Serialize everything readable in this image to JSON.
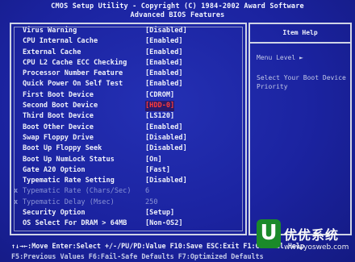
{
  "header": {
    "line1": "CMOS Setup Utility - Copyright (C) 1984-2002 Award Software",
    "line2": "Advanced BIOS Features"
  },
  "settings": [
    {
      "label": "Virus Warning",
      "value": "[Disabled]"
    },
    {
      "label": "CPU Internal Cache",
      "value": "[Enabled]"
    },
    {
      "label": "External Cache",
      "value": "[Enabled]"
    },
    {
      "label": "CPU L2 Cache ECC Checking",
      "value": "[Enabled]"
    },
    {
      "label": "Processor Number Feature",
      "value": "[Enabled]"
    },
    {
      "label": "Quick Power On Self Test",
      "value": "[Enabled]"
    },
    {
      "label": "First Boot Device",
      "value": "[CDROM]"
    },
    {
      "label": "Second Boot Device",
      "value": "[HDD-0]"
    },
    {
      "label": "Third Boot Device",
      "value": "[LS120]"
    },
    {
      "label": "Boot Other Device",
      "value": "[Enabled]"
    },
    {
      "label": "Swap Floppy Drive",
      "value": "[Disabled]"
    },
    {
      "label": "Boot Up Floppy Seek",
      "value": "[Disabled]"
    },
    {
      "label": "Boot Up NumLock Status",
      "value": "[On]"
    },
    {
      "label": "Gate A20 Option",
      "value": "[Fast]"
    },
    {
      "label": "Typematic Rate Setting",
      "value": "[Disabled]"
    },
    {
      "label": "Typematic Rate (Chars/Sec)",
      "value": "6"
    },
    {
      "label": "Typematic Delay (Msec)",
      "value": "250"
    },
    {
      "label": "Security Option",
      "value": "[Setup]"
    },
    {
      "label": "OS Select For DRAM > 64MB",
      "value": "[Non-OS2]"
    }
  ],
  "dim_marker": "x",
  "help": {
    "title": "Item Help",
    "menu_level": "Menu Level  ►",
    "text": "Select Your Boot Device Priority"
  },
  "footer": {
    "line1": "↑↓→←:Move  Enter:Select  +/-/PU/PD:Value  F10:Save  ESC:Exit  F1:General Help",
    "line2": "F5:Previous Values    F6:Fail-Safe Defaults    F7:Optimized Defaults"
  },
  "watermark": {
    "logo": "U",
    "text": "优优系统",
    "url": "www.yosweb.com"
  },
  "colors": {
    "background": "#1b23a0",
    "text": "#eef0fa",
    "highlight": "#ff3a3a",
    "disabled": "#8a93d6"
  }
}
